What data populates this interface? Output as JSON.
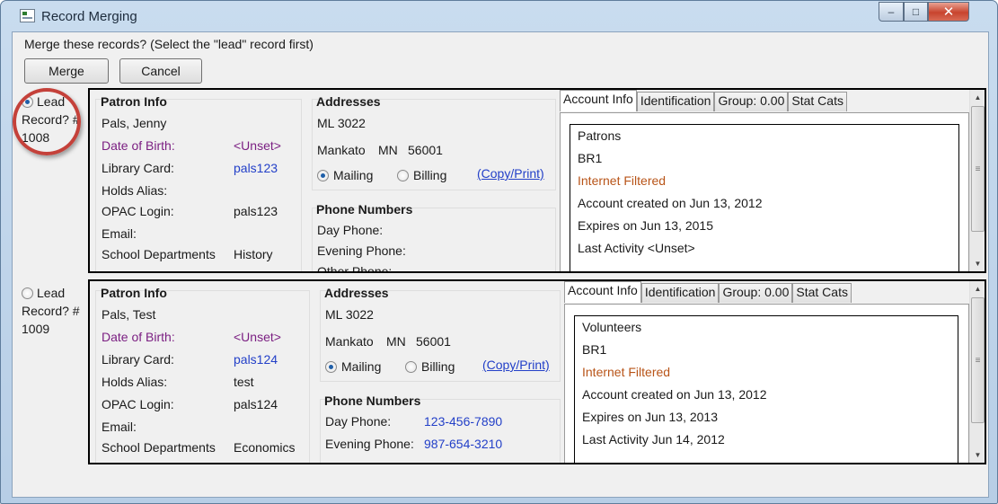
{
  "window": {
    "title": "Record Merging",
    "controls": {
      "minimize": "–",
      "maximize": "□",
      "close": "✕"
    }
  },
  "prompt": "Merge these records? (Select the \"lead\" record first)",
  "buttons": {
    "merge": "Merge",
    "cancel": "Cancel"
  },
  "records": [
    {
      "lead_label_1": "Lead",
      "lead_label_2": "Record? #",
      "lead_id": "1008",
      "selected": true,
      "patron_info": {
        "title": "Patron Info",
        "name": "Pals, Jenny",
        "dob_label": "Date of Birth:",
        "dob_value": "<Unset>",
        "library_card_label": "Library Card:",
        "library_card_value": "pals123",
        "holds_alias_label": "Holds Alias:",
        "holds_alias_value": "",
        "opac_login_label": "OPAC Login:",
        "opac_login_value": "pals123",
        "email_label": "Email:",
        "email_value": "",
        "school_dept_label": "School Departments",
        "school_dept_value": "History"
      },
      "addresses": {
        "title": "Addresses",
        "line1": "ML 3022",
        "city": "Mankato",
        "state": "MN",
        "zip": "56001",
        "mailing_label": "Mailing",
        "billing_label": "Billing",
        "mailing_selected": true,
        "copy_print": "(Copy/Print)"
      },
      "phone_numbers": {
        "title": "Phone Numbers",
        "day_label": "Day Phone:",
        "day_value": "",
        "evening_label": "Evening Phone:",
        "evening_value": "",
        "other_label": "Other Phone:"
      },
      "tabs": [
        "Account Info",
        "Identification",
        "Group: 0.00",
        "Stat Cats"
      ],
      "account": {
        "profile": "Patrons",
        "home_lib": "BR1",
        "filter": "Internet Filtered",
        "created": "Account created on Jun 13, 2012",
        "expires": "Expires on Jun 13, 2015",
        "last_activity": "Last Activity <Unset>"
      }
    },
    {
      "lead_label_1": "Lead",
      "lead_label_2": "Record? #",
      "lead_id": "1009",
      "selected": false,
      "patron_info": {
        "title": "Patron Info",
        "name": "Pals, Test",
        "dob_label": "Date of Birth:",
        "dob_value": "<Unset>",
        "library_card_label": "Library Card:",
        "library_card_value": "pals124",
        "holds_alias_label": "Holds Alias:",
        "holds_alias_value": "test",
        "opac_login_label": "OPAC Login:",
        "opac_login_value": "pals124",
        "email_label": "Email:",
        "email_value": "",
        "school_dept_label": "School Departments",
        "school_dept_value": "Economics"
      },
      "addresses": {
        "title": "Addresses",
        "line1": "ML 3022",
        "city": "Mankato",
        "state": "MN",
        "zip": "56001",
        "mailing_label": "Mailing",
        "billing_label": "Billing",
        "mailing_selected": true,
        "copy_print": "(Copy/Print)"
      },
      "phone_numbers": {
        "title": "Phone Numbers",
        "day_label": "Day Phone:",
        "day_value": "123-456-7890",
        "evening_label": "Evening Phone:",
        "evening_value": "987-654-3210"
      },
      "tabs": [
        "Account Info",
        "Identification",
        "Group: 0.00",
        "Stat Cats"
      ],
      "account": {
        "profile": "Volunteers",
        "home_lib": "BR1",
        "filter": "Internet Filtered",
        "created": "Account created on Jun 13, 2012",
        "expires": "Expires on Jun 13, 2013",
        "last_activity": "Last Activity Jun 14, 2012"
      }
    }
  ],
  "colors": {
    "accent_link": "#2340c8",
    "dob_label": "#7b1f82",
    "filter_text": "#b85418",
    "highlight_ring": "#c4413a"
  },
  "icons": {
    "scroll_up": "▲",
    "scroll_down": "▼",
    "scroll_grip": "≡"
  }
}
